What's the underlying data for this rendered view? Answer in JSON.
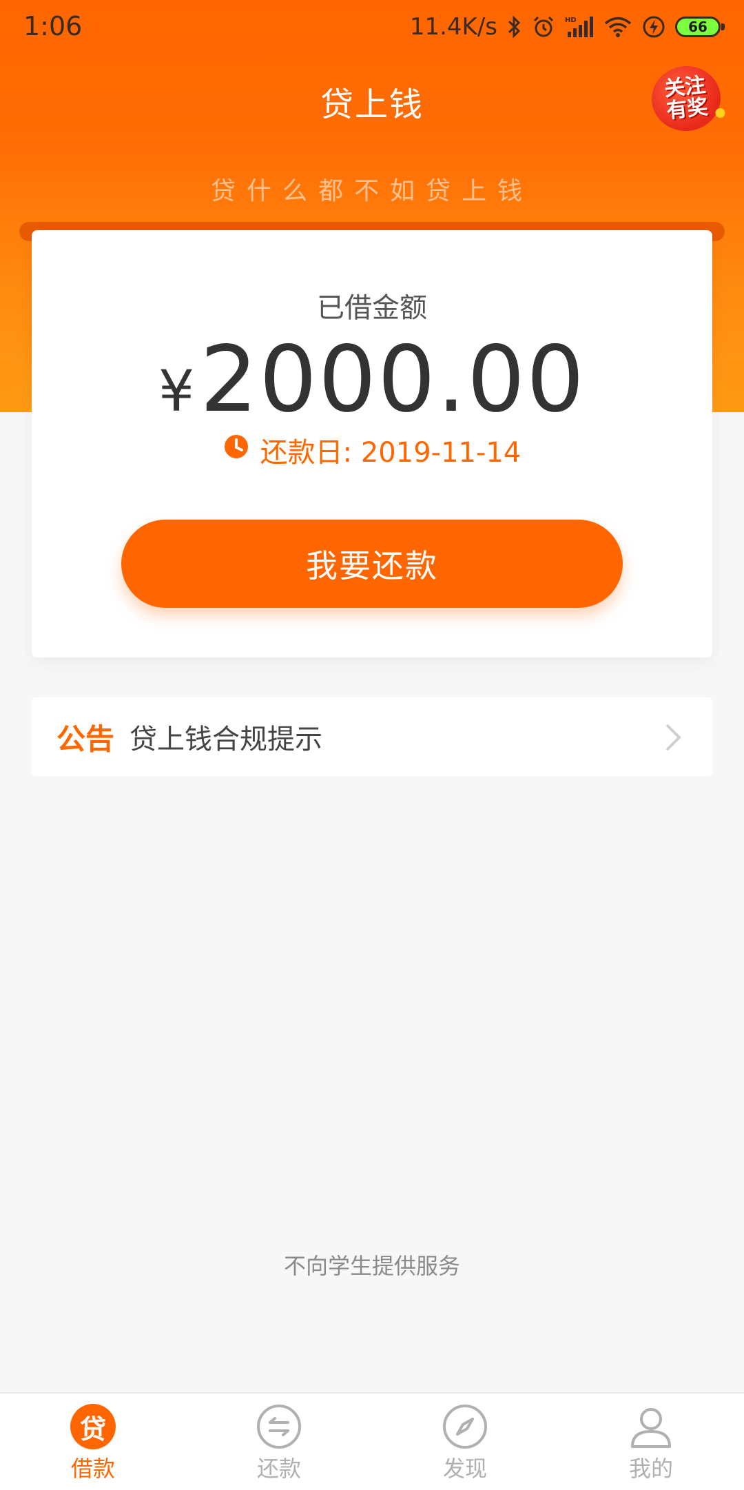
{
  "status_bar": {
    "time": "1:06",
    "network_speed": "11.4K/s",
    "battery_level": "66",
    "icons": [
      "bluetooth-icon",
      "alarm-icon",
      "hd-signal-icon",
      "wifi-icon",
      "charging-icon",
      "battery-icon"
    ]
  },
  "header": {
    "title": "贷上钱",
    "promo_badge": {
      "line1": "关注",
      "line2": "有奖"
    },
    "slogan": "贷什么都不如贷上钱"
  },
  "loan_card": {
    "label": "已借金额",
    "currency_symbol": "¥",
    "amount": "2000.00",
    "due_label": "还款日: 2019-11-14",
    "repay_button": "我要还款"
  },
  "notice": {
    "tag": "公告",
    "text": "贷上钱合规提示"
  },
  "footer_note": "不向学生提供服务",
  "tab_bar": {
    "items": [
      {
        "label": "借款",
        "icon_glyph": "贷",
        "active": true
      },
      {
        "label": "还款",
        "active": false
      },
      {
        "label": "发现",
        "active": false
      },
      {
        "label": "我的",
        "active": false
      }
    ]
  },
  "colors": {
    "brand": "#ff6600",
    "badge_red": "#e8291a",
    "background": "#f7f7f7",
    "tab_inactive": "#b0b0b0"
  }
}
